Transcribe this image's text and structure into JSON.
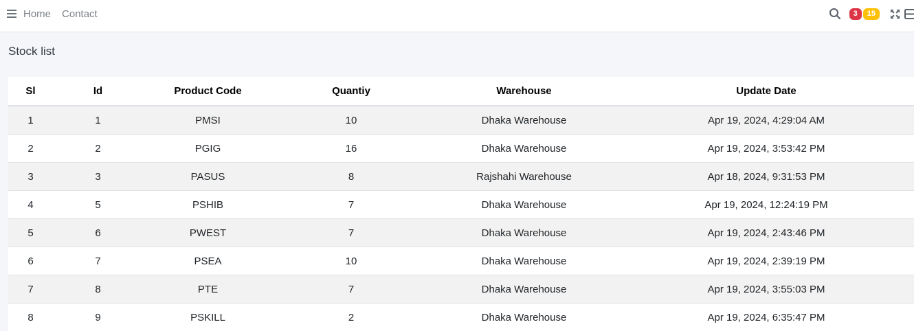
{
  "nav": {
    "links": [
      "Home",
      "Contact"
    ],
    "badges": {
      "danger": "3",
      "warning": "15"
    },
    "icons": [
      "hamburger-icon",
      "search-icon",
      "expand-icon",
      "panel-icon"
    ]
  },
  "page": {
    "title": "Stock list"
  },
  "table": {
    "headers": [
      "Sl",
      "Id",
      "Product Code",
      "Quantiy",
      "Warehouse",
      "Update Date"
    ],
    "rows": [
      [
        "1",
        "1",
        "PMSI",
        "10",
        "Dhaka Warehouse",
        "Apr 19, 2024, 4:29:04 AM"
      ],
      [
        "2",
        "2",
        "PGIG",
        "16",
        "Dhaka Warehouse",
        "Apr 19, 2024, 3:53:42 PM"
      ],
      [
        "3",
        "3",
        "PASUS",
        "8",
        "Rajshahi Warehouse",
        "Apr 18, 2024, 9:31:53 PM"
      ],
      [
        "4",
        "5",
        "PSHIB",
        "7",
        "Dhaka Warehouse",
        "Apr 19, 2024, 12:24:19 PM"
      ],
      [
        "5",
        "6",
        "PWEST",
        "7",
        "Dhaka Warehouse",
        "Apr 19, 2024, 2:43:46 PM"
      ],
      [
        "6",
        "7",
        "PSEA",
        "10",
        "Dhaka Warehouse",
        "Apr 19, 2024, 2:39:19 PM"
      ],
      [
        "7",
        "8",
        "PTE",
        "7",
        "Dhaka Warehouse",
        "Apr 19, 2024, 3:55:03 PM"
      ],
      [
        "8",
        "9",
        "PSKILL",
        "2",
        "Dhaka Warehouse",
        "Apr 19, 2024, 6:35:47 PM"
      ]
    ]
  },
  "colors": {
    "danger": "#dc3545",
    "warning": "#ffc107",
    "stripe": "#f2f2f2",
    "background": "#f4f6f9"
  }
}
